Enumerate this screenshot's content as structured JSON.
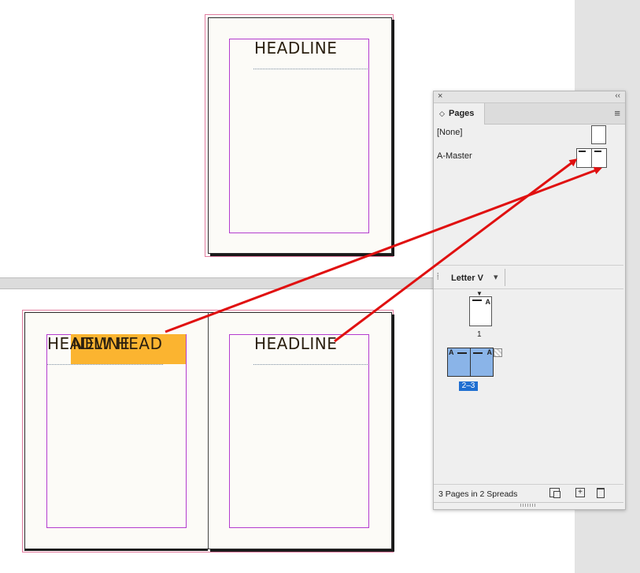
{
  "document": {
    "master_headline": "HEADLINE",
    "spread_left_headline": "HEADLINE",
    "spread_left_overlap_text": "NEW HEAD",
    "spread_right_headline": "HEADLINE"
  },
  "pages_panel": {
    "tab_label": "Pages",
    "tab_chevron": "◇",
    "menu_icon": "≡",
    "masters": [
      {
        "label": "[None]"
      },
      {
        "label": "A-Master"
      }
    ],
    "size_selector": {
      "label": "Letter V",
      "chevron": "▾"
    },
    "pages": [
      {
        "number_label": "1",
        "prefix": "A"
      },
      {
        "number_label": "2–3",
        "prefix_left": "A",
        "prefix_right": "A",
        "selected": true
      }
    ],
    "status": "3 Pages in 2 Spreads",
    "footer_icons": [
      "edit-page-size-icon",
      "new-page-icon",
      "trash-icon"
    ]
  },
  "colors": {
    "arrow": "#e01010",
    "selection": "#8ab4e8",
    "badge": "#1f6fd1",
    "orange_frame": "#fbb430"
  }
}
